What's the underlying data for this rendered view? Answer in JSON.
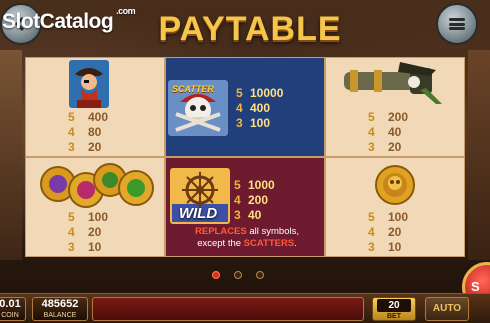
{
  "header": {
    "logo_slot": "Slot",
    "logo_catalog": "Catalog",
    "logo_suffix": ".com",
    "title": "PAYTABLE"
  },
  "paytable": {
    "pirate": [
      {
        "n": "5",
        "v": "400"
      },
      {
        "n": "4",
        "v": "80"
      },
      {
        "n": "3",
        "v": "20"
      }
    ],
    "scatter": {
      "label": "SCATTER",
      "pays": [
        {
          "n": "5",
          "v": "10000"
        },
        {
          "n": "4",
          "v": "400"
        },
        {
          "n": "3",
          "v": "100"
        }
      ]
    },
    "cannon": [
      {
        "n": "5",
        "v": "200"
      },
      {
        "n": "4",
        "v": "40"
      },
      {
        "n": "3",
        "v": "20"
      }
    ],
    "coins": [
      {
        "n": "5",
        "v": "100"
      },
      {
        "n": "4",
        "v": "20"
      },
      {
        "n": "3",
        "v": "10"
      }
    ],
    "wild": {
      "label": "WILD",
      "pays": [
        {
          "n": "5",
          "v": "1000"
        },
        {
          "n": "4",
          "v": "200"
        },
        {
          "n": "3",
          "v": "40"
        }
      ],
      "note_hl1": "REPLACES",
      "note_mid": " all symbols,",
      "note_line2": "except the ",
      "note_hl2": "SCATTERS",
      "note_end": "."
    },
    "gold_coin": [
      {
        "n": "5",
        "v": "100"
      },
      {
        "n": "4",
        "v": "20"
      },
      {
        "n": "3",
        "v": "10"
      }
    ]
  },
  "pager": {
    "pages": 3,
    "active": 0
  },
  "bottom_bar": {
    "coin_value": "0.01",
    "coin_label": "COIN",
    "balance_value": "485652",
    "balance_label": "BALANCE",
    "bet_value": "20",
    "bet_label": "BET",
    "auto_label": "AUTO",
    "spin_label": "S"
  },
  "colors": {
    "accent": "#f6c64a",
    "scatter_bg": "#213f7a",
    "wild_bg": "#6e1a2f",
    "cell_bg": "#f1d9b8"
  }
}
